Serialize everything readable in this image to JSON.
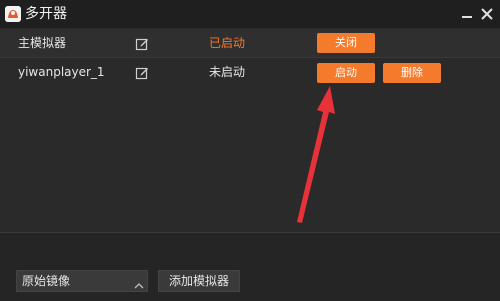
{
  "window": {
    "title": "多开器",
    "icon": "app-logo-icon",
    "minimize_icon": "minimize-icon",
    "close_icon": "close-icon"
  },
  "instances": [
    {
      "name": "主模拟器",
      "status": "已启动",
      "status_color": "#f47a2c",
      "actions": [
        "关闭"
      ]
    },
    {
      "name": "yiwanplayer_1",
      "status": "未启动",
      "status_color": "#e6e6e6",
      "actions": [
        "启动",
        "删除"
      ]
    }
  ],
  "footer": {
    "image_select_value": "原始镜像",
    "add_button_label": "添加模拟器"
  },
  "colors": {
    "accent": "#f47a2c",
    "annotation_arrow": "#e8323a",
    "background": "#2a2a2a"
  }
}
